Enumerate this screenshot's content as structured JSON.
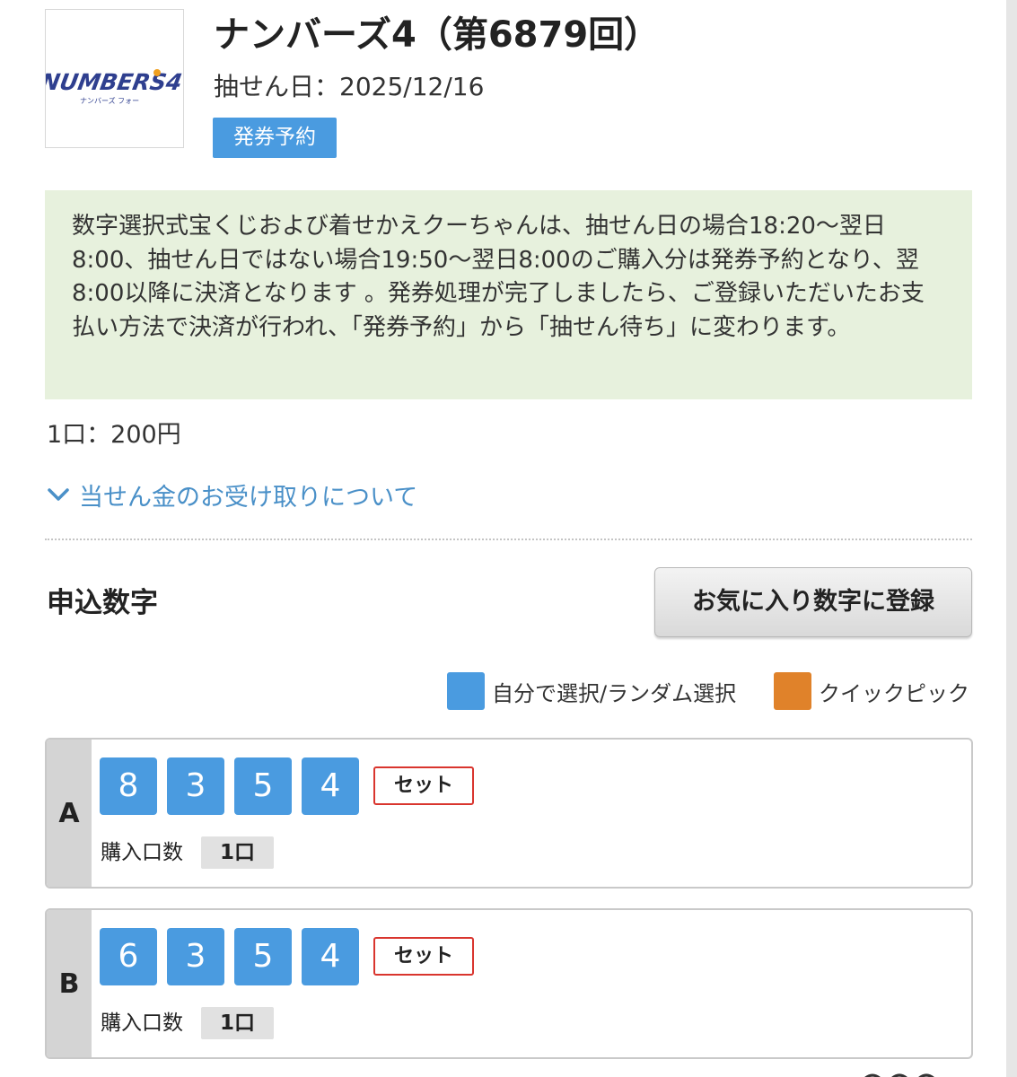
{
  "header": {
    "logo_text": "NUMBERS4",
    "logo_subtext": "ナンバーズ フォー",
    "title": "ナンバーズ4（第6879回）",
    "draw_date": "抽せん日：2025/12/16",
    "status": "発券予約"
  },
  "notice": {
    "text": "数字選択式宝くじおよび着せかえクーちゃんは、抽せん日の場合18:20〜翌日8:00、抽せん日ではない場合19:50〜翌日8:00のご購入分は発券予約となり、翌8:00以降に決済となります 。発券処理が完了しましたら、ご登録いただいたお支払い方法で決済が行われ、「発券予約」から「抽せん待ち」に変わります。"
  },
  "price": "1口：200円",
  "prize_link": "当せん金のお受け取りについて",
  "section": {
    "title": "申込数字",
    "favorite_button": "お気に入り数字に登録"
  },
  "legend": [
    {
      "label": "自分で選択/ランダム選択",
      "color": "#4a9be0"
    },
    {
      "label": "クイックピック",
      "color": "#e0822a"
    }
  ],
  "rows": [
    {
      "letter": "A",
      "digits": [
        "8",
        "3",
        "5",
        "4"
      ],
      "type": "セット",
      "qty_label": "購入口数",
      "qty": "1口"
    },
    {
      "letter": "B",
      "digits": [
        "6",
        "3",
        "5",
        "4"
      ],
      "type": "セット",
      "qty_label": "購入口数",
      "qty": "1口"
    }
  ],
  "colors": {
    "primary_blue": "#4a9be0",
    "quick_pick_orange": "#e0822a",
    "link_blue": "#4a90c8",
    "notice_bg": "#e7f1dd",
    "tag_red": "#d9352e"
  }
}
